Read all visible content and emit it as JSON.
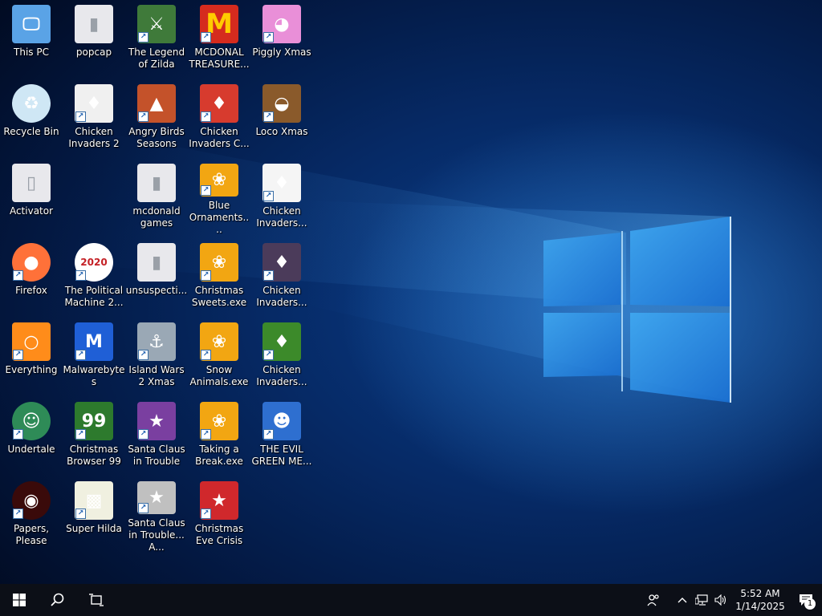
{
  "desktop": {
    "icons": [
      {
        "label": "This PC",
        "icon": "computer-icon",
        "color": "#5aa3e6"
      },
      {
        "label": "popcap",
        "icon": "folder-icon",
        "color": "#e8e8ec"
      },
      {
        "label": "The Legend of Zilda",
        "icon": "game-icon",
        "color": "#3f7a3a"
      },
      {
        "label": "MCDONAL TREASURE...",
        "icon": "mcdonalds-icon",
        "color": "#d52b1e"
      },
      {
        "label": "Piggly Xmas",
        "icon": "pig-icon",
        "color": "#e98fd8"
      },
      {
        "label": "Recycle Bin",
        "icon": "recycle-bin-icon",
        "color": "#cfe7f5"
      },
      {
        "label": "Chicken Invaders 2",
        "icon": "chicken-icon",
        "color": "#f0f0f0"
      },
      {
        "label": "Angry Birds Seasons",
        "icon": "angry-birds-icon",
        "color": "#c4522a"
      },
      {
        "label": "Chicken Invaders C...",
        "icon": "chicken-icon",
        "color": "#d73b2e"
      },
      {
        "label": "Loco Xmas",
        "icon": "bear-icon",
        "color": "#8a5a2b"
      },
      {
        "label": "Activator",
        "icon": "file-icon",
        "color": "#e8e8ec"
      },
      {
        "label": "mcdonald games",
        "icon": "folder-icon",
        "color": "#e8e8ec"
      },
      {
        "label": "Blue Ornaments....",
        "icon": "popcap-flower-icon",
        "color": "#f2a612"
      },
      {
        "label": "Chicken Invaders...",
        "icon": "chicken-icon",
        "color": "#f5f5f5"
      },
      {
        "label": "Firefox",
        "icon": "firefox-icon",
        "color": "#ff7139"
      },
      {
        "label": "The Political Machine 2...",
        "icon": "political-machine-icon",
        "color": "#c42025"
      },
      {
        "label": "unsuspecti...",
        "icon": "folder-icon",
        "color": "#e8e8ec"
      },
      {
        "label": "Christmas Sweets.exe",
        "icon": "popcap-flower-icon",
        "color": "#f2a612"
      },
      {
        "label": "Chicken Invaders...",
        "icon": "chicken-icon",
        "color": "#4b3b5a"
      },
      {
        "label": "Everything",
        "icon": "search-icon",
        "color": "#ff8c1a"
      },
      {
        "label": "Malwarebytes",
        "icon": "malwarebytes-icon",
        "color": "#1f5fd6"
      },
      {
        "label": "Island Wars 2 Xmas",
        "icon": "island-wars-icon",
        "color": "#9aa8b5"
      },
      {
        "label": "Snow Animals.exe",
        "icon": "popcap-flower-icon",
        "color": "#f2a612"
      },
      {
        "label": "Chicken Invaders...",
        "icon": "chicken-icon",
        "color": "#3c8a2a"
      },
      {
        "label": "Undertale",
        "icon": "undertale-icon",
        "color": "#2e8b57"
      },
      {
        "label": "Christmas Browser 99",
        "icon": "xmas-tree-icon",
        "color": "#2d7a2d"
      },
      {
        "label": "Santa Claus in Trouble",
        "icon": "santa-icon",
        "color": "#7a3fa0"
      },
      {
        "label": "Taking a Break.exe",
        "icon": "popcap-flower-icon",
        "color": "#f2a612"
      },
      {
        "label": "THE EVIL GREEN ME...",
        "icon": "messenger-icon",
        "color": "#2e6fd0"
      },
      {
        "label": "Papers, Please",
        "icon": "papers-please-icon",
        "color": "#3a0a0a"
      },
      {
        "label": "Super Hilda",
        "icon": "hilda-icon",
        "color": "#f0f0e0"
      },
      {
        "label": "Santa Claus in Trouble... A...",
        "icon": "santa-icon",
        "color": "#c0c0c0"
      },
      {
        "label": "Christmas Eve Crisis",
        "icon": "santa-icon",
        "color": "#d0282c"
      }
    ]
  },
  "taskbar": {
    "start_icon": "windows-start-icon",
    "search_icon": "search-icon",
    "taskview_icon": "task-view-icon"
  },
  "tray": {
    "time": "5:52 AM",
    "date": "1/14/2025",
    "notification_count": "1"
  }
}
